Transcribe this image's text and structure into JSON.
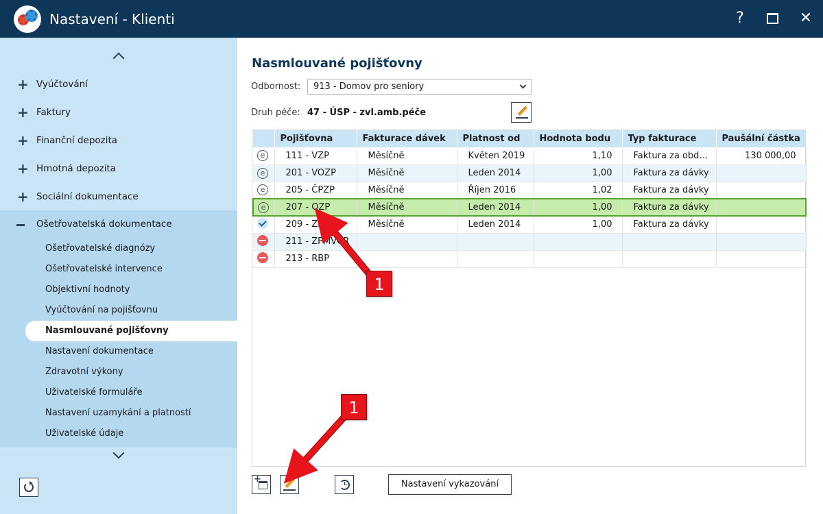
{
  "window": {
    "title": "Nastavení - Klienti",
    "help_label": "?",
    "close_label": "✕",
    "logo_icon": "gears-icon"
  },
  "sidebar": {
    "top_items": [
      {
        "label": "Vyúčtování",
        "icon": "plus"
      },
      {
        "label": "Faktury",
        "icon": "plus"
      },
      {
        "label": "Finanční depozita",
        "icon": "plus"
      },
      {
        "label": "Hmotná depozita",
        "icon": "plus"
      },
      {
        "label": "Sociální dokumentace",
        "icon": "plus"
      }
    ],
    "expanded": {
      "label": "Ošetřovatelská dokumentace",
      "icon": "minus",
      "sub_items": [
        {
          "label": "Ošetřovatelské diagnózy"
        },
        {
          "label": "Ošetřovatelské intervence"
        },
        {
          "label": "Objektivní hodnoty"
        },
        {
          "label": "Vyúčtování na pojišťovnu"
        },
        {
          "label": "Nasmlouvané pojišťovny",
          "active": true
        },
        {
          "label": "Nastavení dokumentace"
        },
        {
          "label": "Zdravotní výkony"
        },
        {
          "label": "Uživatelské formuláře"
        },
        {
          "label": "Nastavení uzamykání a platností"
        },
        {
          "label": "Uživatelské údaje"
        }
      ]
    }
  },
  "main": {
    "title": "Nasmlouvané pojišťovny",
    "odbornost": {
      "label": "Odbornost:",
      "value": "913 - Domov pro seniory"
    },
    "druh_pece": {
      "label": "Druh péče:",
      "value": "47 - ÚSP - zvl.amb.péče"
    },
    "table": {
      "columns": [
        "Pojišťovna",
        "Fakturace dávek",
        "Platnost od",
        "Hodnota bodu",
        "Typ fakturace",
        "Paušální částka"
      ],
      "rows": [
        {
          "status": "e",
          "pojistovna": "111 - VZP",
          "fakturace": "Měsíčně",
          "platnost": "Květen 2019",
          "hodnota": "1,10",
          "typ": "Faktura za obd…",
          "pausal": "130 000,00"
        },
        {
          "status": "e",
          "pojistovna": "201 - VOZP",
          "fakturace": "Měsíčně",
          "platnost": "Leden 2014",
          "hodnota": "1,00",
          "typ": "Faktura za dávky",
          "pausal": ""
        },
        {
          "status": "e",
          "pojistovna": "205 - ČPZP",
          "fakturace": "Měsíčně",
          "platnost": "Říjen 2016",
          "hodnota": "1,02",
          "typ": "Faktura za dávky",
          "pausal": ""
        },
        {
          "status": "e",
          "pojistovna": "207 - OZP",
          "fakturace": "Měsíčně",
          "platnost": "Leden 2014",
          "hodnota": "1,00",
          "typ": "Faktura za dávky",
          "pausal": "",
          "selected": true
        },
        {
          "status": "ok",
          "pojistovna": "209 - ZP",
          "fakturace": "Měsíčně",
          "platnost": "Leden 2014",
          "hodnota": "1,00",
          "typ": "Faktura za dávky",
          "pausal": ""
        },
        {
          "status": "no",
          "pojistovna": "211 - ZPMVČR",
          "fakturace": "",
          "platnost": "",
          "hodnota": "",
          "typ": "",
          "pausal": ""
        },
        {
          "status": "no",
          "pojistovna": "213 - RBP",
          "fakturace": "",
          "platnost": "",
          "hodnota": "",
          "typ": "",
          "pausal": ""
        }
      ]
    },
    "buttons": {
      "nastaveni_vykazovani": "Nastavení vykazování"
    }
  },
  "annotations": {
    "callout_1": "1",
    "callout_2": "1",
    "color": "#e8141c"
  },
  "colors": {
    "titlebar": "#0e3659",
    "sidebar": "#c9e4f5",
    "selected_row": "#c6ecac",
    "header": "#c9e4f5"
  }
}
